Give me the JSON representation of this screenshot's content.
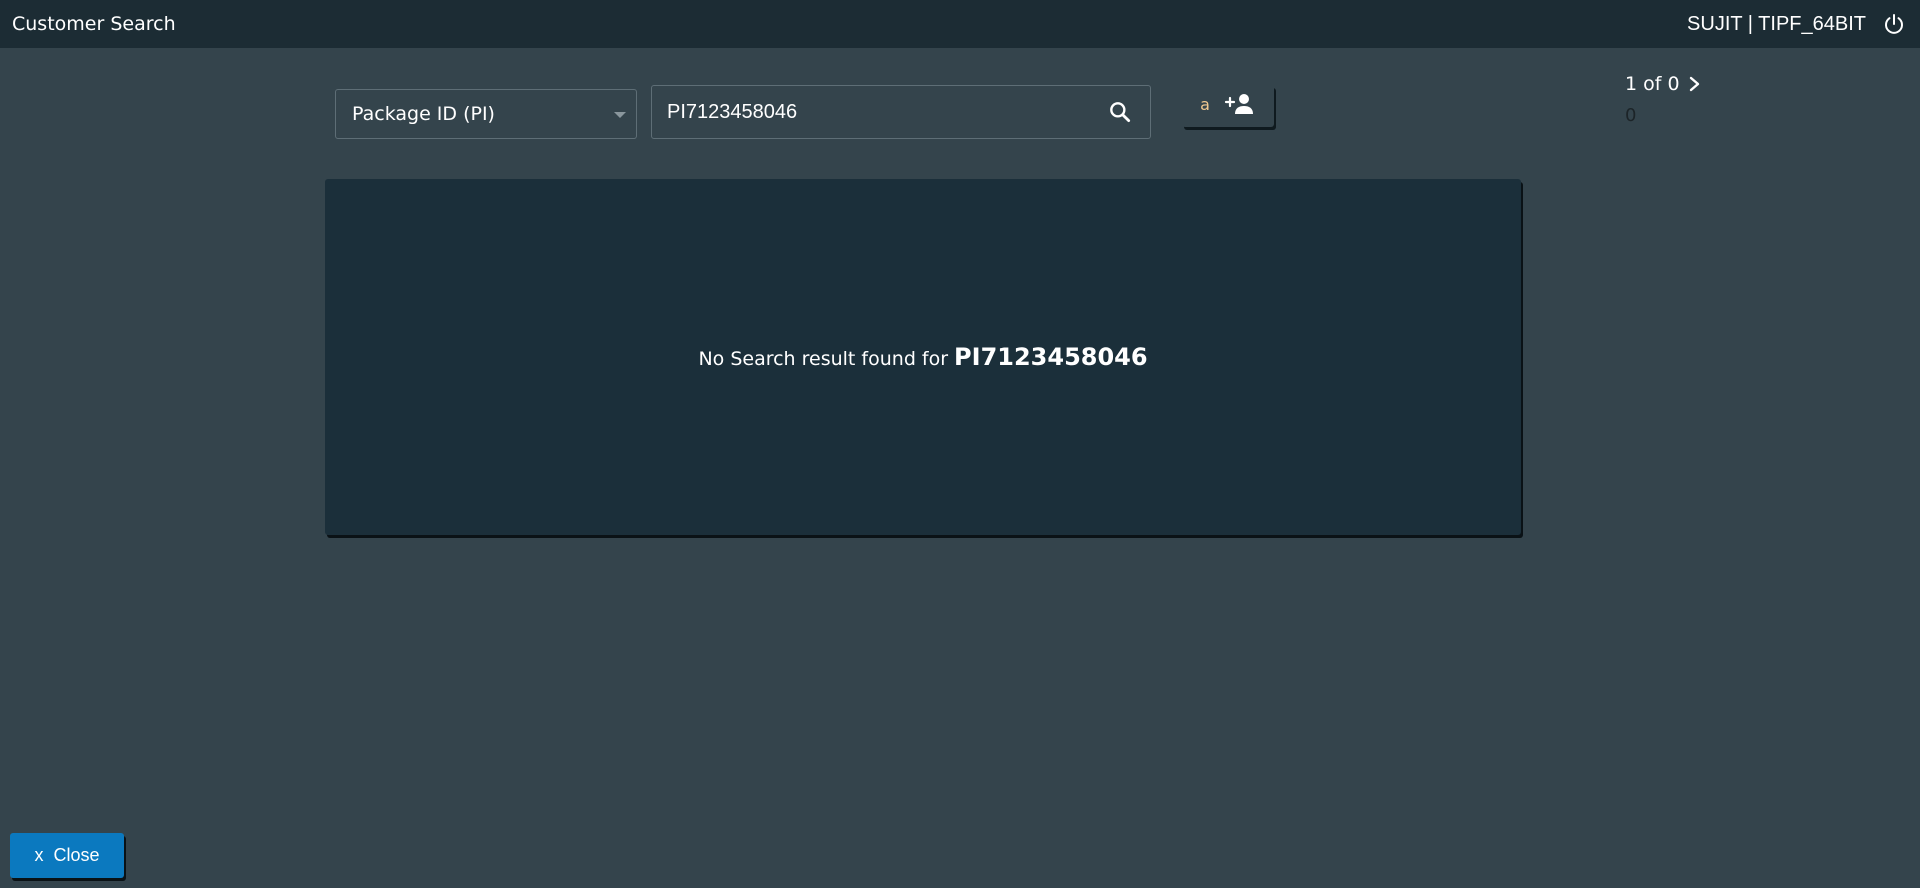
{
  "header": {
    "title": "Customer Search",
    "user": "SUJIT | TIPF_64BIT",
    "power_icon": "power-icon"
  },
  "search": {
    "type_selected": "Package ID (PI)",
    "query": "PI7123458046",
    "search_icon": "search-icon"
  },
  "add_customer": {
    "shortcut_key": "a",
    "icon": "person-add-icon"
  },
  "pager": {
    "position": "1 of 0",
    "count": "0",
    "next_icon": "chevron-right-icon"
  },
  "results": {
    "message": "No Search result found for",
    "term": "PI7123458046"
  },
  "footer": {
    "close_prefix": "x",
    "close_label": "Close"
  }
}
